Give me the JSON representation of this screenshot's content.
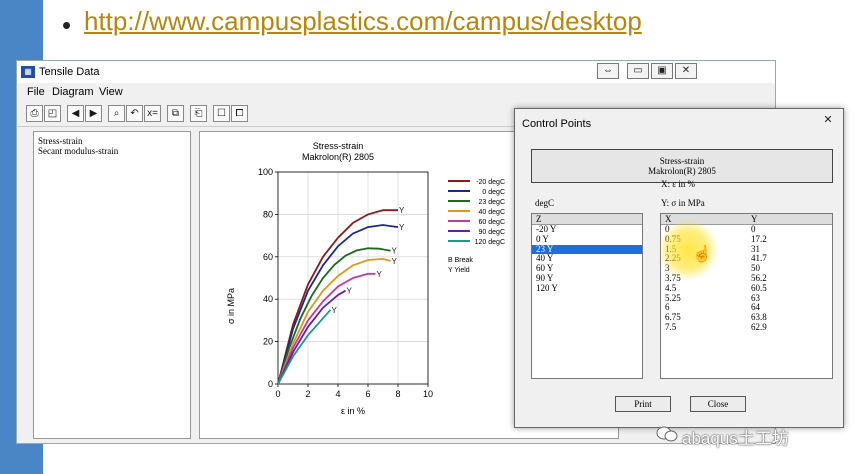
{
  "slide": {
    "url": "http://www.campusplastics.com/campus/desktop",
    "watermark": "abaqus土工坊"
  },
  "window": {
    "title": "Tensile Data",
    "menu": [
      "File",
      "Diagram",
      "View"
    ],
    "tree_items": [
      "Stress-strain",
      "Secant modulus-strain"
    ]
  },
  "chart_data": {
    "type": "line",
    "title": "Stress-strain",
    "subtitle": "Makrolon(R) 2805",
    "xlabel": "ε in %",
    "ylabel": "σ in MPa",
    "xlim": [
      0,
      10
    ],
    "ylim": [
      0,
      100
    ],
    "xticks": [
      "0",
      "2",
      "4",
      "6",
      "8",
      "10"
    ],
    "yticks": [
      "0",
      "20",
      "40",
      "60",
      "80",
      "100"
    ],
    "legend_note": [
      "B Break",
      "Y Yield"
    ],
    "end_marker": "Y",
    "series": [
      {
        "name": "-20 degC",
        "color": "#8b1a1a",
        "x": [
          0,
          1,
          2,
          3,
          4,
          5,
          6,
          7,
          8
        ],
        "y": [
          0,
          28,
          47,
          60,
          69,
          76,
          80,
          82,
          82
        ]
      },
      {
        "name": "0 degC",
        "color": "#1a2a8b",
        "x": [
          0,
          1,
          2,
          3,
          4,
          5,
          6,
          7,
          8
        ],
        "y": [
          0,
          26,
          44,
          56,
          65,
          71,
          74,
          75,
          74
        ]
      },
      {
        "name": "23 degC",
        "color": "#1a6b1a",
        "x": [
          0,
          0.75,
          1.5,
          2.25,
          3,
          3.75,
          4.5,
          5.25,
          6,
          6.75,
          7.5
        ],
        "y": [
          0,
          17.2,
          31,
          41.7,
          50,
          56.2,
          60.5,
          63,
          64,
          63.8,
          62.9
        ]
      },
      {
        "name": "40 degC",
        "color": "#e0961a",
        "x": [
          0,
          1,
          2,
          3,
          4,
          5,
          6,
          7,
          7.5
        ],
        "y": [
          0,
          19,
          34,
          44,
          51,
          56,
          58.5,
          59,
          58
        ]
      },
      {
        "name": "60 degC",
        "color": "#c03aa0",
        "x": [
          0,
          1,
          2,
          3,
          4,
          5,
          6,
          6.5
        ],
        "y": [
          0,
          17,
          30,
          39,
          46,
          50,
          52,
          52
        ]
      },
      {
        "name": "90 degC",
        "color": "#6a1ab0",
        "x": [
          0,
          1,
          2,
          3,
          4,
          4.5
        ],
        "y": [
          0,
          15,
          27,
          36,
          42,
          44
        ]
      },
      {
        "name": "120 degC",
        "color": "#1a9a8a",
        "x": [
          0,
          1,
          2,
          3,
          3.5
        ],
        "y": [
          0,
          13,
          23,
          31,
          35
        ]
      }
    ]
  },
  "dialog": {
    "title": "Control Points",
    "close": "✕",
    "head_title": "Stress-strain",
    "head_sub": "Makrolon(R) 2805",
    "x_axis_label": "X: ε in %",
    "y_axis_label": "Y: σ in MPa",
    "param_label": "degC",
    "z_header": "Z",
    "z_list": [
      "-20 Y",
      "0 Y",
      "23 Y",
      "40 Y",
      "60 Y",
      "90 Y",
      "120 Y"
    ],
    "z_selected": 2,
    "x_header": "X",
    "y_header": "Y",
    "points": [
      [
        "0",
        "0"
      ],
      [
        "0.75",
        "17.2"
      ],
      [
        "1.5",
        "31"
      ],
      [
        "2.25",
        "41.7"
      ],
      [
        "3",
        "50"
      ],
      [
        "3.75",
        "56.2"
      ],
      [
        "4.5",
        "60.5"
      ],
      [
        "5.25",
        "63"
      ],
      [
        "6",
        "64"
      ],
      [
        "6.75",
        "63.8"
      ],
      [
        "7.5",
        "62.9"
      ]
    ],
    "print_label": "Print",
    "close_label": "Close"
  }
}
